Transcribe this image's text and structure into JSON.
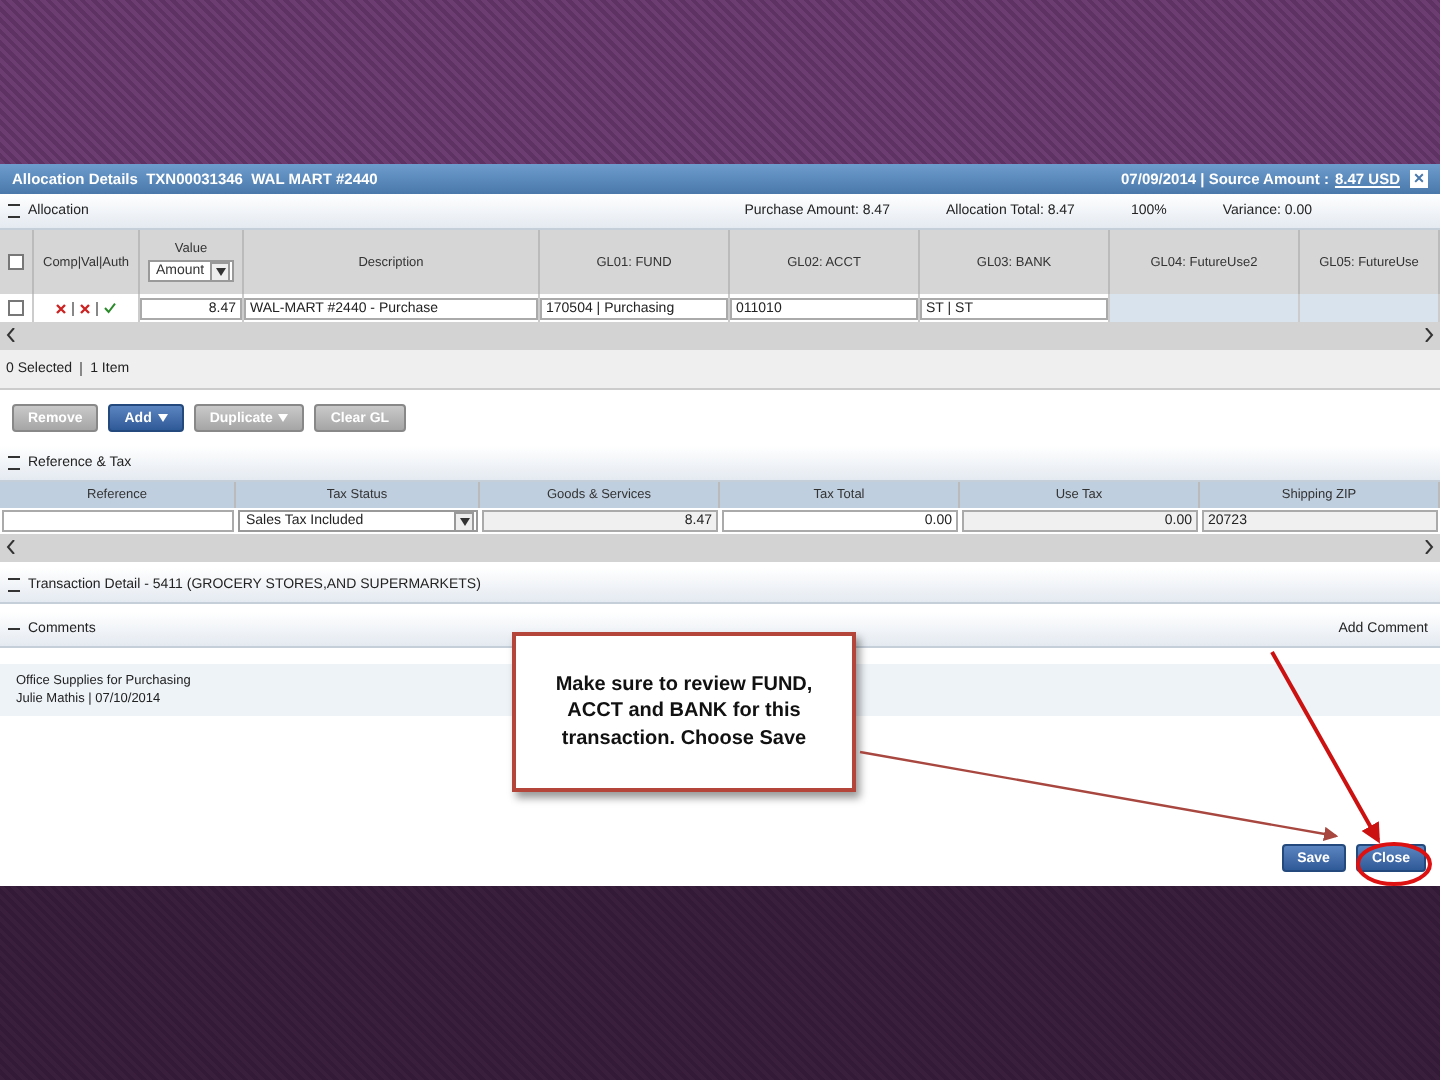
{
  "window": {
    "title": "Allocation Details  TXN00031346  WAL MART #2440",
    "date": "07/09/2014 | Source Amount :",
    "source_amount": "8.47 USD",
    "close": "×"
  },
  "allocation": {
    "title": "Allocation",
    "purchase_amount": "Purchase Amount: 8.47",
    "allocation_total": "Allocation Total: 8.47",
    "percent": "100%",
    "variance": "Variance: 0.00",
    "header_selected": false,
    "columns": [
      "Comp|Val|Auth",
      "Value",
      "Description",
      "GL01: FUND",
      "GL02: ACCT",
      "GL03: BANK",
      "GL04: FutureUse2",
      "GL05: FutureUse"
    ],
    "value_select": "Amount",
    "rows": [
      {
        "selected": false,
        "comp": false,
        "val": false,
        "auth": true,
        "value": "8.47",
        "description": "WAL-MART #2440 - Purchase",
        "gl01": "170504 | Purchasing",
        "gl02": "011010",
        "gl03": "ST | ST"
      }
    ],
    "selected_count": "0 Selected",
    "item_count": "1 Item",
    "buttons": [
      {
        "label": "Remove",
        "kind": "plain",
        "menu": false
      },
      {
        "label": "Add",
        "kind": "primary",
        "menu": true
      },
      {
        "label": "Duplicate",
        "kind": "plain",
        "menu": true
      },
      {
        "label": "Clear GL",
        "kind": "plain",
        "menu": false
      }
    ]
  },
  "reference_tax": {
    "title": "Reference & Tax",
    "columns": [
      "Reference",
      "Tax Status",
      "Goods & Services",
      "Tax Total",
      "Use Tax",
      "Shipping ZIP"
    ],
    "tax_status": "Sales Tax Included",
    "goods_services": "8.47",
    "tax_total": "0.00",
    "use_tax": "0.00",
    "shipping_zip": "20723"
  },
  "transaction_detail": {
    "title": "Transaction Detail - 5411 (GROCERY STORES,AND SUPERMARKETS)"
  },
  "comments": {
    "title": "Comments",
    "add": "Add Comment",
    "items": [
      {
        "text": "Office Supplies for Purchasing",
        "meta": "Julie Mathis | 07/10/2014"
      }
    ]
  },
  "footer_buttons": [
    "Save",
    "Close"
  ],
  "callout": "Make sure to review FUND, ACCT and BANK for this transaction.  Choose Save"
}
